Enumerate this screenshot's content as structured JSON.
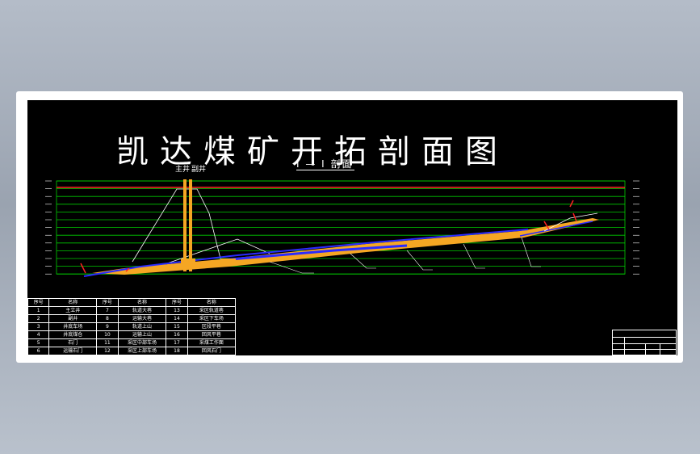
{
  "drawing": {
    "title": "凯达煤矿开拓剖面图",
    "section_label": "I — I 剖面",
    "shaft_labels": [
      "主井",
      "副井"
    ]
  },
  "legend": {
    "headers": [
      "序号",
      "名称",
      "序号",
      "名称",
      "序号",
      "名称"
    ],
    "rows": [
      [
        "1",
        "主立井",
        "7",
        "轨道大巷",
        "13",
        "采区轨道巷"
      ],
      [
        "2",
        "副井",
        "8",
        "运输大巷",
        "14",
        "采区下车场"
      ],
      [
        "3",
        "井底车场",
        "9",
        "轨道上山",
        "15",
        "区段平巷"
      ],
      [
        "4",
        "井底煤仓",
        "10",
        "运输上山",
        "16",
        "回风平巷"
      ],
      [
        "5",
        "石门",
        "11",
        "采区中部车场",
        "17",
        "采煤工作面"
      ],
      [
        "6",
        "运输石门",
        "12",
        "采区上部车场",
        "18",
        "回风石门"
      ]
    ]
  },
  "colors": {
    "seam": "#f5a623",
    "roadway": "#2a2aff",
    "grid": "#00cc00",
    "ground": "#ff2222",
    "line": "#ffffff"
  }
}
